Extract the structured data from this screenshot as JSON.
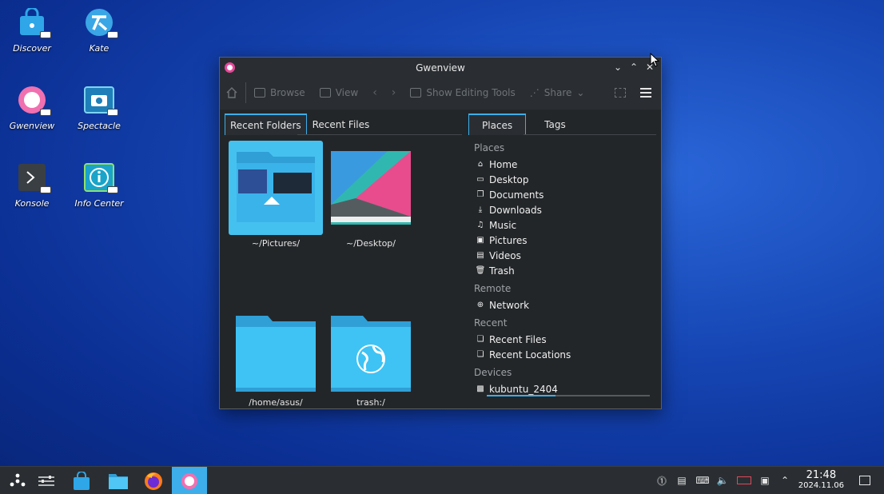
{
  "desktop": {
    "icons": [
      {
        "label": "Discover",
        "icon": "shopping-bag-icon"
      },
      {
        "label": "Kate",
        "icon": "kate-icon"
      },
      {
        "label": "Gwenview",
        "icon": "gwenview-icon"
      },
      {
        "label": "Spectacle",
        "icon": "camera-icon"
      },
      {
        "label": "Konsole",
        "icon": "terminal-icon"
      },
      {
        "label": "Info Center",
        "icon": "info-icon"
      }
    ]
  },
  "window": {
    "title": "Gwenview",
    "toolbar": {
      "browse": "Browse",
      "view": "View",
      "editing": "Show Editing Tools",
      "share": "Share"
    },
    "left_tabs": [
      "Recent Folders",
      "Recent Files"
    ],
    "folders": [
      "~/Pictures/",
      "~/Desktop/",
      "/home/asus/",
      "trash:/"
    ],
    "right_tabs": [
      "Places",
      "Tags"
    ],
    "places": {
      "places_header": "Places",
      "places_items": [
        "Home",
        "Desktop",
        "Documents",
        "Downloads",
        "Music",
        "Pictures",
        "Videos",
        "Trash"
      ],
      "remote_header": "Remote",
      "remote_items": [
        "Network"
      ],
      "recent_header": "Recent",
      "recent_items": [
        "Recent Files",
        "Recent Locations"
      ],
      "devices_header": "Devices",
      "devices_items": [
        "kubuntu_2404"
      ]
    }
  },
  "taskbar": {
    "time": "21:48",
    "date": "2024.11.06",
    "accent": "#3daee9"
  }
}
